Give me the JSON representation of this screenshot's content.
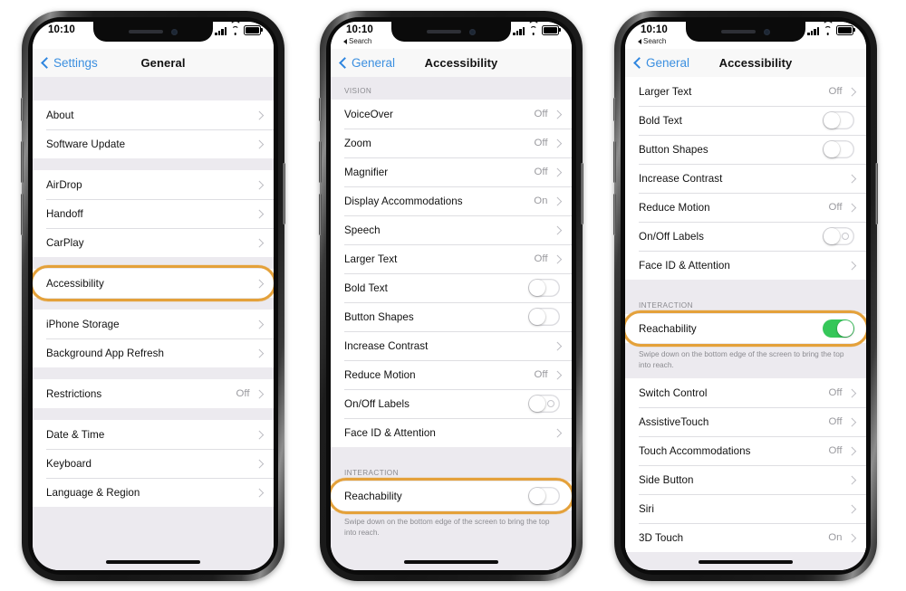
{
  "meta": {
    "accent_orange": "#E4A13A",
    "toggle_on_green": "#35C759",
    "link_blue": "#3B8FE0",
    "screen_bg": "#ECEAEF"
  },
  "icons": {
    "chevron_left": "chevron-left-icon",
    "chevron_right": "chevron-right-icon",
    "signal": "cellular-signal-icon",
    "wifi": "wifi-icon",
    "battery": "battery-icon",
    "back_triangle": "back-triangle-icon",
    "speaker": "earpiece-speaker-icon",
    "front_camera": "front-camera-icon",
    "home_indicator": "home-indicator-icon"
  },
  "phones": [
    {
      "id": "phone-1",
      "status": {
        "time": "10:10",
        "back_app": null
      },
      "nav": {
        "back_label": "Settings",
        "title": "General"
      },
      "sections": [
        {
          "caption": null,
          "gap": "lg",
          "rows": [
            {
              "label": "About",
              "value": null,
              "type": "disclosure"
            },
            {
              "label": "Software Update",
              "value": null,
              "type": "disclosure"
            }
          ]
        },
        {
          "caption": null,
          "gap": "sm",
          "rows": [
            {
              "label": "AirDrop",
              "value": null,
              "type": "disclosure"
            },
            {
              "label": "Handoff",
              "value": null,
              "type": "disclosure"
            },
            {
              "label": "CarPlay",
              "value": null,
              "type": "disclosure"
            }
          ]
        },
        {
          "caption": null,
          "gap": "sm",
          "highlight": true,
          "rows": [
            {
              "label": "Accessibility",
              "value": null,
              "type": "disclosure",
              "highlighted": true
            }
          ]
        },
        {
          "caption": null,
          "gap": "sm",
          "rows": [
            {
              "label": "iPhone Storage",
              "value": null,
              "type": "disclosure"
            },
            {
              "label": "Background App Refresh",
              "value": null,
              "type": "disclosure"
            }
          ]
        },
        {
          "caption": null,
          "gap": "sm",
          "rows": [
            {
              "label": "Restrictions",
              "value": "Off",
              "type": "disclosure"
            }
          ]
        },
        {
          "caption": null,
          "gap": "sm",
          "rows": [
            {
              "label": "Date & Time",
              "value": null,
              "type": "disclosure"
            },
            {
              "label": "Keyboard",
              "value": null,
              "type": "disclosure"
            },
            {
              "label": "Language & Region",
              "value": null,
              "type": "disclosure"
            }
          ]
        }
      ]
    },
    {
      "id": "phone-2",
      "status": {
        "time": "10:10",
        "back_app": "Search"
      },
      "nav": {
        "back_label": "General",
        "title": "Accessibility"
      },
      "sections": [
        {
          "caption": "VISION",
          "gap": "none",
          "rows": [
            {
              "label": "VoiceOver",
              "value": "Off",
              "type": "disclosure"
            },
            {
              "label": "Zoom",
              "value": "Off",
              "type": "disclosure"
            },
            {
              "label": "Magnifier",
              "value": "Off",
              "type": "disclosure"
            },
            {
              "label": "Display Accommodations",
              "value": "On",
              "type": "disclosure"
            },
            {
              "label": "Speech",
              "value": null,
              "type": "disclosure"
            },
            {
              "label": "Larger Text",
              "value": "Off",
              "type": "disclosure"
            },
            {
              "label": "Bold Text",
              "value": null,
              "type": "switch",
              "on": false
            },
            {
              "label": "Button Shapes",
              "value": null,
              "type": "switch",
              "on": false
            },
            {
              "label": "Increase Contrast",
              "value": null,
              "type": "disclosure"
            },
            {
              "label": "Reduce Motion",
              "value": "Off",
              "type": "disclosure"
            },
            {
              "label": "On/Off Labels",
              "value": null,
              "type": "switch",
              "on": false,
              "label_marker": true
            },
            {
              "label": "Face ID & Attention",
              "value": null,
              "type": "disclosure"
            }
          ]
        },
        {
          "caption": "INTERACTION",
          "gap": "sm",
          "highlight": true,
          "rows": [
            {
              "label": "Reachability",
              "value": null,
              "type": "switch",
              "on": false,
              "highlighted": true
            }
          ],
          "footnote": "Swipe down on the bottom edge of the screen to bring the top into reach."
        }
      ]
    },
    {
      "id": "phone-3",
      "status": {
        "time": "10:10",
        "back_app": "Search"
      },
      "nav": {
        "back_label": "General",
        "title": "Accessibility"
      },
      "sections": [
        {
          "caption": null,
          "gap": "none",
          "rows": [
            {
              "label": "Larger Text",
              "value": "Off",
              "type": "disclosure"
            },
            {
              "label": "Bold Text",
              "value": null,
              "type": "switch",
              "on": false
            },
            {
              "label": "Button Shapes",
              "value": null,
              "type": "switch",
              "on": false
            },
            {
              "label": "Increase Contrast",
              "value": null,
              "type": "disclosure"
            },
            {
              "label": "Reduce Motion",
              "value": "Off",
              "type": "disclosure"
            },
            {
              "label": "On/Off Labels",
              "value": null,
              "type": "switch",
              "on": false,
              "label_marker": true
            },
            {
              "label": "Face ID & Attention",
              "value": null,
              "type": "disclosure"
            }
          ]
        },
        {
          "caption": "INTERACTION",
          "gap": "sm",
          "highlight": true,
          "rows": [
            {
              "label": "Reachability",
              "value": null,
              "type": "switch",
              "on": true,
              "highlighted": true
            }
          ],
          "footnote": "Swipe down on the bottom edge of the screen to bring the top into reach."
        },
        {
          "caption": null,
          "gap": "none",
          "rows": [
            {
              "label": "Switch Control",
              "value": "Off",
              "type": "disclosure"
            },
            {
              "label": "AssistiveTouch",
              "value": "Off",
              "type": "disclosure"
            },
            {
              "label": "Touch Accommodations",
              "value": "Off",
              "type": "disclosure"
            },
            {
              "label": "Side Button",
              "value": null,
              "type": "disclosure"
            },
            {
              "label": "Siri",
              "value": null,
              "type": "disclosure"
            },
            {
              "label": "3D Touch",
              "value": "On",
              "type": "disclosure"
            }
          ]
        }
      ]
    }
  ]
}
